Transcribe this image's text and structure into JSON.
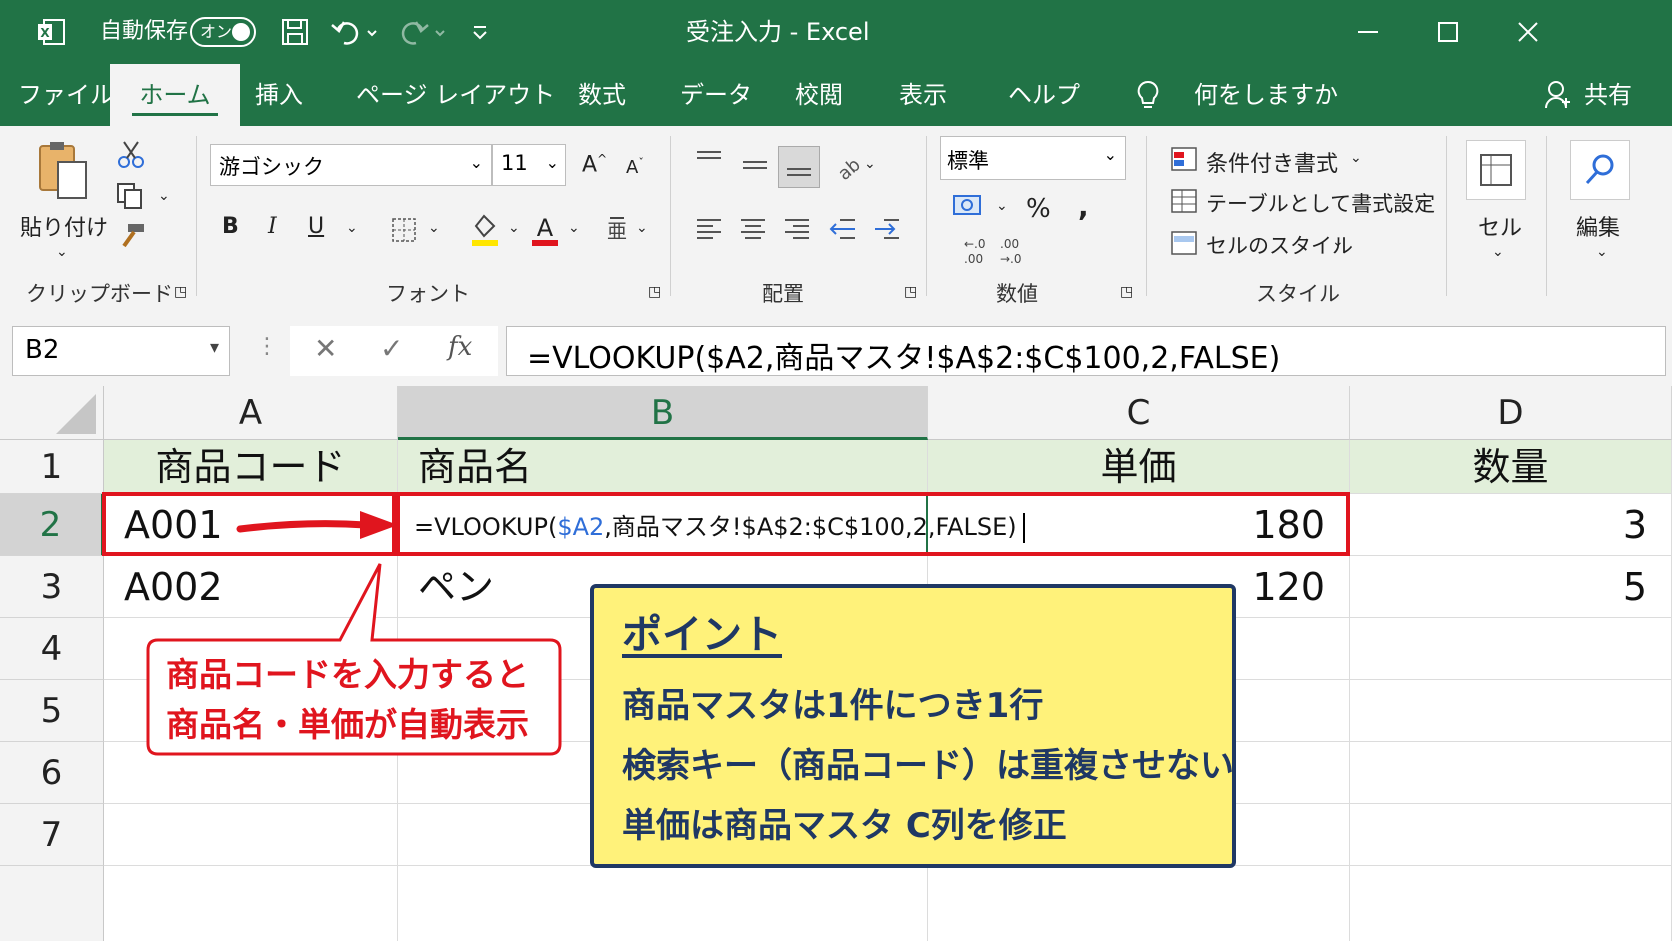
{
  "titlebar": {
    "autosave_label": "自動保存",
    "autosave_state": "オン",
    "title": "受注入力  -  Excel"
  },
  "tabs": [
    "ファイル",
    "ホーム",
    "挿入",
    "ページ レイアウト",
    "数式",
    "データ",
    "校閲",
    "表示",
    "ヘルプ"
  ],
  "tell_me": "何をしますか",
  "share": "共有",
  "ribbon": {
    "clipboard": {
      "paste_label": "貼り付け",
      "group_label": "クリップボード"
    },
    "font": {
      "font_name": "游ゴシック",
      "font_size": "11",
      "bold": "B",
      "italic": "I",
      "underline": "U",
      "group_label": "フォント"
    },
    "alignment": {
      "group_label": "配置"
    },
    "number": {
      "format": "標準",
      "percent": "%",
      "comma": ",",
      "group_label": "数値"
    },
    "styles": {
      "conditional": "条件付き書式",
      "table": "テーブルとして書式設定",
      "cell_styles": "セルのスタイル",
      "group_label": "スタイル"
    },
    "cells": {
      "label": "セル"
    },
    "editing": {
      "label": "編集"
    }
  },
  "formula_bar": {
    "name_box": "B2",
    "formula": "=VLOOKUP($A2,商品マスタ!$A$2:$C$100,2,FALSE)"
  },
  "columns": [
    "A",
    "B",
    "C",
    "D"
  ],
  "rows": [
    "1",
    "2",
    "3",
    "4",
    "5",
    "6",
    "7"
  ],
  "cells": {
    "A1": "商品コード",
    "B1": "商品名",
    "C1": "単価",
    "D1": "数量",
    "A2": "A001",
    "B2_prefix": "=VLOOKUP(",
    "B2_ref": "$A2",
    "B2_rest": ",商品マスタ!$A$2:$C$100,2,FALSE)",
    "C2": "180",
    "D2": "3",
    "A3": "A002",
    "B3": "ペン",
    "C3": "120",
    "D3": "5"
  },
  "callout_red": {
    "line1": "商品コードを入力すると",
    "line2": "商品名・単価が自動表示"
  },
  "callout_point": {
    "title": "ポイント",
    "lines": [
      "商品マスタは1件につき1行",
      "検索キー（商品コード）は重複させない",
      "単価は商品マスタ C列を修正"
    ]
  },
  "colors": {
    "excel_green": "#217346",
    "header_fill": "#e2efda",
    "highlight_red": "#e0151e",
    "point_bg": "#fff27a",
    "point_border": "#1f3864",
    "ref_blue": "#2f6ed8"
  },
  "icons": [
    "excel-icon",
    "save-icon",
    "undo-icon",
    "redo-icon",
    "customize-icon",
    "minimize-icon",
    "maximize-icon",
    "close-icon",
    "lightbulb-icon",
    "person-icon",
    "paste-icon",
    "cut-icon",
    "copy-icon",
    "format-painter-icon",
    "search-icon"
  ]
}
